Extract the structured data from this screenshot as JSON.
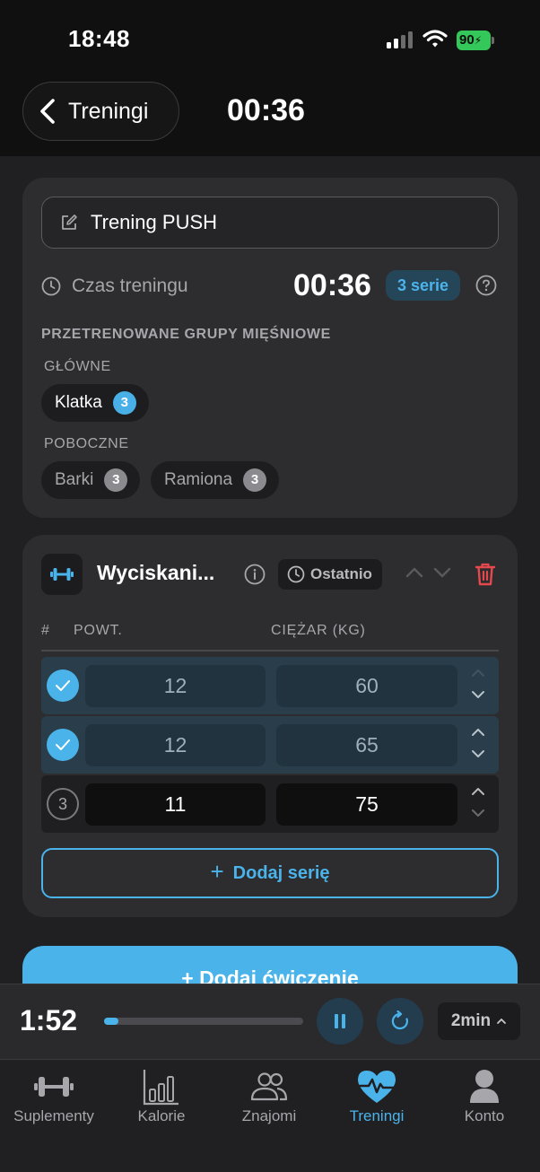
{
  "status_bar": {
    "time": "18:48",
    "battery": "90"
  },
  "header": {
    "back_label": "Treningi",
    "timer": "00:36"
  },
  "workout": {
    "name": "Trening PUSH",
    "time_label": "Czas treningu",
    "time_value": "00:36",
    "series_badge": "3 serie",
    "muscles_title": "PRZETRENOWANE GRUPY MIĘŚNIOWE",
    "primary_label": "GŁÓWNE",
    "primary": [
      {
        "name": "Klatka",
        "count": "3"
      }
    ],
    "secondary_label": "POBOCZNE",
    "secondary": [
      {
        "name": "Barki",
        "count": "3"
      },
      {
        "name": "Ramiona",
        "count": "3"
      }
    ]
  },
  "exercise": {
    "title": "Wyciskani...",
    "last_label": "Ostatnio",
    "col_number": "#",
    "col_reps": "POWT.",
    "col_weight": "CIĘŻAR (KG)",
    "sets": [
      {
        "number": "1",
        "reps": "12",
        "weight": "60",
        "done": true
      },
      {
        "number": "2",
        "reps": "12",
        "weight": "65",
        "done": true
      },
      {
        "number": "3",
        "reps": "11",
        "weight": "75",
        "done": false
      }
    ],
    "add_set_label": "Dodaj serię"
  },
  "add_exercise_label": "+ Dodaj ćwiczenie",
  "rest_timer": {
    "time": "1:52",
    "progress": 0.07,
    "duration": "2min"
  },
  "tabs": [
    {
      "label": "Suplementy",
      "icon": "dumbbell-icon",
      "active": false
    },
    {
      "label": "Kalorie",
      "icon": "bar-chart-icon",
      "active": false
    },
    {
      "label": "Znajomi",
      "icon": "people-icon",
      "active": false
    },
    {
      "label": "Treningi",
      "icon": "heart-pulse-icon",
      "active": true
    },
    {
      "label": "Konto",
      "icon": "person-icon",
      "active": false
    }
  ],
  "colors": {
    "accent": "#4ab3ea",
    "danger": "#e5484d",
    "background": "#202023",
    "card": "#2d2d30"
  }
}
